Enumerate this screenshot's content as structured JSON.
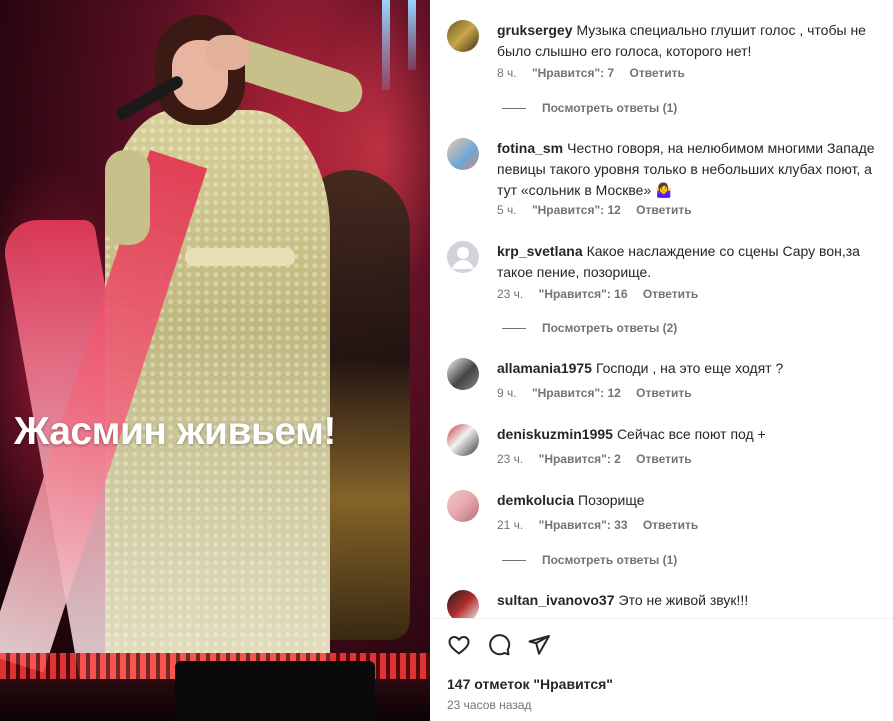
{
  "post": {
    "caption_overlay": "Жасмин живьем!"
  },
  "comments": [
    {
      "username": "gruksergey",
      "text": "Музыка специально глушит голос , чтобы не было слышно его голоса, которого нет!",
      "time": "8 ч.",
      "likes": "\"Нравится\": 7",
      "reply": "Ответить",
      "view_replies": "Посмотреть ответы (1)"
    },
    {
      "username": "fotina_sm",
      "text": "Честно говоря, на нелюбимом многими Западе певицы такого уровня только в небольших клубах поют, а тут «сольник в Москве» 🤷‍♀",
      "time": "5 ч.",
      "likes": "\"Нравится\": 12",
      "reply": "Ответить"
    },
    {
      "username": "krp_svetlana",
      "text": "Какое наслаждение со сцены Сару вон,за такое пение, позорище.",
      "time": "23 ч.",
      "likes": "\"Нравится\": 16",
      "reply": "Ответить",
      "view_replies": "Посмотреть ответы (2)"
    },
    {
      "username": "allamania1975",
      "text": "Господи , на это еще ходят ?",
      "time": "9 ч.",
      "likes": "\"Нравится\": 12",
      "reply": "Ответить"
    },
    {
      "username": "deniskuzmin1995",
      "text": "Сейчас все поют под +",
      "time": "23 ч.",
      "likes": "\"Нравится\": 2",
      "reply": "Ответить"
    },
    {
      "username": "demkolucia",
      "text": "Позорище",
      "time": "21 ч.",
      "likes": "\"Нравится\": 33",
      "reply": "Ответить",
      "view_replies": "Посмотреть ответы (1)"
    },
    {
      "username": "sultan_ivanovo37",
      "text": "Это не живой звук!!!"
    }
  ],
  "footer": {
    "like_icon": "heart-icon",
    "comment_icon": "comment-icon",
    "share_icon": "share-icon",
    "likes_total": "147 отметок \"Нравится\"",
    "time_ago": "23 часов назад"
  },
  "colors": {
    "text": "#262626",
    "secondary": "#737373",
    "divider": "#efefef",
    "caption": "#ffffff"
  }
}
